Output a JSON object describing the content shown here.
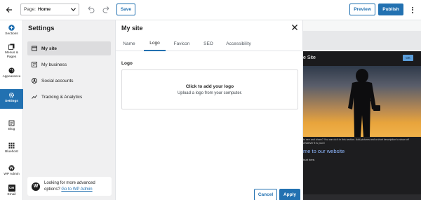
{
  "topbar": {
    "page_label": "Page:",
    "page_value": "Home",
    "save_label": "Save",
    "preview_label": "Preview",
    "publish_label": "Publish"
  },
  "rail": {
    "items": [
      {
        "label": "Sections",
        "icon": "plus-circle-icon"
      },
      {
        "label": "Menus & Pages",
        "icon": "pages-icon"
      },
      {
        "label": "Appearance",
        "icon": "palette-icon"
      },
      {
        "label": "Settings",
        "icon": "gear-icon"
      },
      {
        "label": "Blog",
        "icon": "blog-icon"
      },
      {
        "label": "Bluehost",
        "icon": "grid-icon"
      },
      {
        "label": "WP Admin",
        "icon": "wordpress-icon"
      },
      {
        "label": "Email",
        "icon": "email-icon",
        "badge": "CM"
      }
    ]
  },
  "settings": {
    "title": "Settings",
    "items": [
      {
        "label": "My site",
        "icon": "my-site-icon"
      },
      {
        "label": "My business",
        "icon": "business-icon"
      },
      {
        "label": "Social accounts",
        "icon": "social-icon"
      },
      {
        "label": "Tracking & Analytics",
        "icon": "analytics-icon"
      }
    ],
    "wp_box": {
      "text": "Looking for more advanced options?",
      "link": "Go to WP Admin"
    }
  },
  "modal": {
    "title": "My site",
    "tabs": [
      "Name",
      "Logo",
      "Favicon",
      "SEO",
      "Accessibility"
    ],
    "active_tab": "Logo",
    "logo_label": "Logo",
    "drop_title": "Click to add your logo",
    "drop_subtitle": "Upload a logo from your computer.",
    "cancel_label": "Cancel",
    "apply_label": "Apply"
  },
  "preview": {
    "site_title": "e Site",
    "go_label": "OK",
    "body_text": "to see and share? You can do it in this section. Add pictures and a short description to show off whatever it is you'd",
    "welcome": "me to our website",
    "learn_more": "hurt here."
  },
  "colors": {
    "accent": "#2271b1",
    "panel_bg": "#f0f0f1"
  }
}
